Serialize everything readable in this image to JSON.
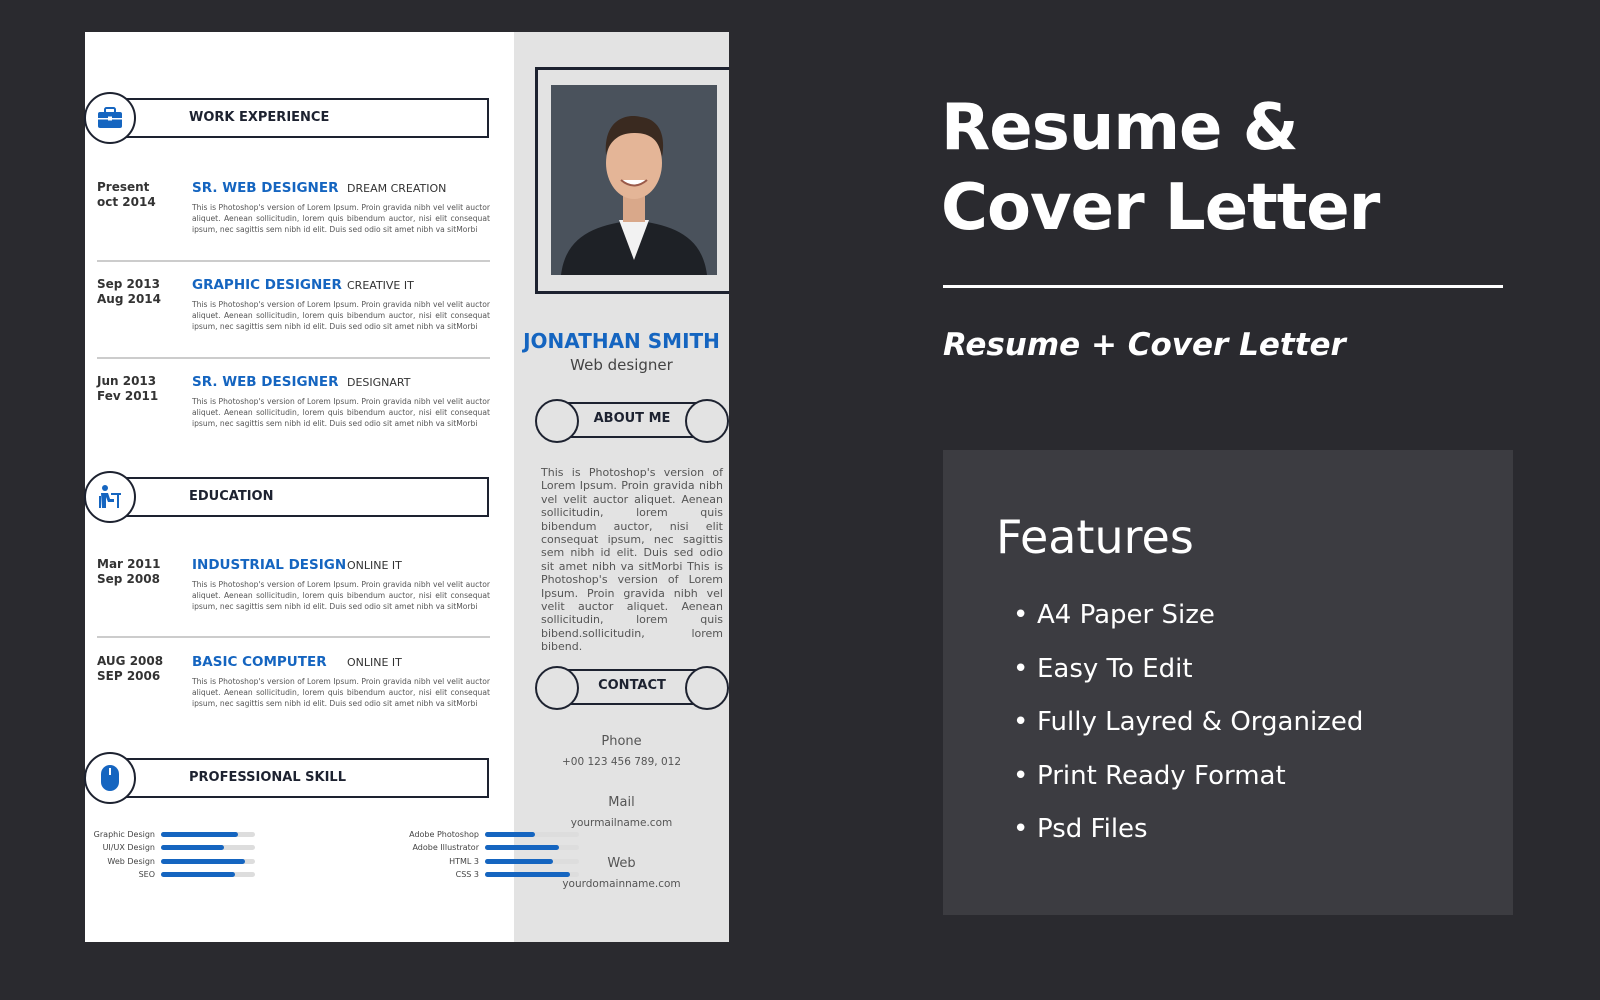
{
  "resume": {
    "work": {
      "heading": "WORK EXPERIENCE",
      "entries": [
        {
          "date1": "Present",
          "date2": "oct 2014",
          "title": "SR. WEB DESIGNER",
          "company": "DREAM CREATION",
          "desc": "This is Photoshop's version of Lorem Ipsum. Proin gravida nibh vel velit auctor aliquet. Aenean sollicitudin, lorem quis bibendum auctor, nisi elit consequat ipsum, nec sagittis sem nibh id elit. Duis sed odio sit amet nibh va sitMorbi"
        },
        {
          "date1": "Sep 2013",
          "date2": "Aug 2014",
          "title": "GRAPHIC DESIGNER",
          "company": "CREATIVE IT",
          "desc": "This is Photoshop's version of Lorem Ipsum. Proin gravida nibh vel velit auctor aliquet. Aenean sollicitudin, lorem quis bibendum auctor, nisi elit consequat ipsum, nec sagittis sem nibh id elit. Duis sed odio sit amet nibh va sitMorbi"
        },
        {
          "date1": "Jun 2013",
          "date2": "Fev 2011",
          "title": "SR. WEB DESIGNER",
          "company": "DESIGNART",
          "desc": "This is Photoshop's version of Lorem Ipsum. Proin gravida nibh vel velit auctor aliquet. Aenean sollicitudin, lorem quis bibendum auctor, nisi elit consequat ipsum, nec sagittis sem nibh id elit. Duis sed odio sit amet nibh va sitMorbi"
        }
      ]
    },
    "education": {
      "heading": "EDUCATION",
      "entries": [
        {
          "date1": "Mar 2011",
          "date2": "Sep 2008",
          "title": "INDUSTRIAL DESIGN",
          "company": "ONLINE IT",
          "desc": "This is Photoshop's version of Lorem Ipsum. Proin gravida nibh vel velit auctor aliquet. Aenean sollicitudin, lorem quis bibendum auctor, nisi elit consequat ipsum, nec sagittis sem nibh id elit. Duis sed odio sit amet nibh va sitMorbi"
        },
        {
          "date1": "AUG 2008",
          "date2": "SEP 2006",
          "title": "BASIC COMPUTER",
          "company": "ONLINE IT",
          "desc": "This is Photoshop's version of Lorem Ipsum. Proin gravida nibh vel velit auctor aliquet. Aenean sollicitudin, lorem quis bibendum auctor, nisi elit consequat ipsum, nec sagittis sem nibh id elit. Duis sed odio sit amet nibh va sitMorbi"
        }
      ]
    },
    "skills": {
      "heading": "PROFESSIONAL SKILL",
      "left": [
        {
          "name": "Graphic Design",
          "level": 82
        },
        {
          "name": "UI/UX Design",
          "level": 67
        },
        {
          "name": "Web Design",
          "level": 89
        },
        {
          "name": "SEO",
          "level": 79
        }
      ],
      "right": [
        {
          "name": "Adobe Photoshop",
          "level": 53
        },
        {
          "name": "Adobe Illustrator",
          "level": 79
        },
        {
          "name": "HTML 3",
          "level": 72
        },
        {
          "name": "CSS 3",
          "level": 90
        }
      ]
    },
    "name": "JONATHAN SMITH",
    "role": "Web designer",
    "about": {
      "heading": "ABOUT ME",
      "text": "This is Photoshop's version of Lorem Ipsum. Proin gravida nibh vel velit auctor aliquet. Aenean sollicitudin, lorem quis bibendum auctor, nisi elit consequat ipsum, nec sagittis sem nibh id elit. Duis sed odio sit amet nibh va sitMorbi This is Photoshop's version of Lorem Ipsum. Proin gravida nibh vel velit auctor aliquet. Aenean sollicitudin, lorem quis bibend.sollicitudin, lorem bibend."
    },
    "contact": {
      "heading": "CONTACT",
      "phone_label": "Phone",
      "phone": "+00 123 456 789, 012",
      "mail_label": "Mail",
      "mail": "yourmailname.com",
      "web_label": "Web",
      "web": "yourdomainname.com"
    },
    "accent": "#1565c0"
  },
  "promo": {
    "title_line1": "Resume &",
    "title_line2": "Cover Letter",
    "subtitle": "Resume + Cover Letter",
    "features_heading": "Features",
    "features": [
      "A4 Paper Size",
      "Easy To Edit",
      "Fully Layred & Organized",
      "Print Ready Format",
      "Psd Files"
    ]
  }
}
